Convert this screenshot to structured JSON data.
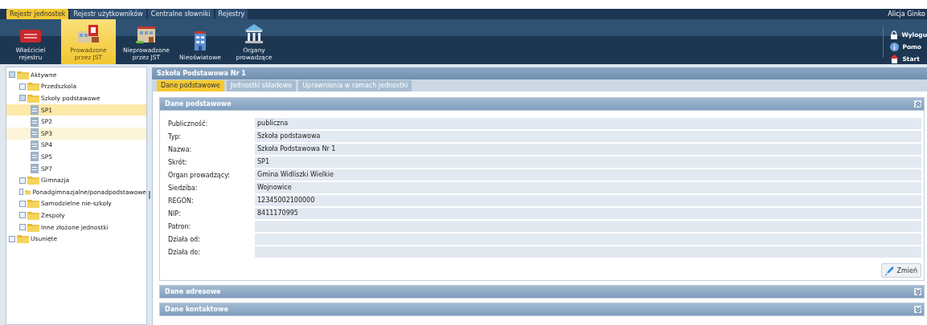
{
  "top_tabs": [
    {
      "label": "Rejestr jednostek",
      "selected": true
    },
    {
      "label": "Rejestr użytkowników",
      "selected": false
    },
    {
      "label": "Centralne słowniki",
      "selected": false
    },
    {
      "label": "Rejestry",
      "selected": false
    }
  ],
  "user": "Alicja Ginko",
  "toolbar": [
    {
      "label": "Właściciel rejestru",
      "kind": "sign",
      "selected": false
    },
    {
      "label": "Prowadzone przez JST",
      "kind": "emblem",
      "selected": true
    },
    {
      "label": "Nieprowadzone przez JST",
      "kind": "building",
      "selected": false
    },
    {
      "label": "Nieoświatowe",
      "kind": "tower",
      "selected": false
    },
    {
      "label": "Organy prowadzące",
      "kind": "temple",
      "selected": false
    }
  ],
  "side_links": [
    {
      "label": "Wylogu",
      "kind": "lock"
    },
    {
      "label": "Pomo",
      "kind": "info"
    },
    {
      "label": "Start",
      "kind": "home"
    }
  ],
  "tree": [
    {
      "label": "Aktywne",
      "kind": "folder",
      "expanded": true,
      "selected": false,
      "hovered": false,
      "children": [
        {
          "label": "Przedszkola",
          "kind": "folder",
          "expanded": false,
          "selected": false,
          "hovered": false
        },
        {
          "label": "Szkoły podstawowe",
          "kind": "folder",
          "expanded": true,
          "selected": false,
          "hovered": false,
          "children": [
            {
              "label": "SP1",
              "kind": "doc",
              "selected": true,
              "hovered": false
            },
            {
              "label": "SP2",
              "kind": "doc",
              "selected": false,
              "hovered": false
            },
            {
              "label": "SP3",
              "kind": "doc",
              "selected": false,
              "hovered": true
            },
            {
              "label": "SP4",
              "kind": "doc",
              "selected": false,
              "hovered": false
            },
            {
              "label": "SP5",
              "kind": "doc",
              "selected": false,
              "hovered": false
            },
            {
              "label": "SP7",
              "kind": "doc",
              "selected": false,
              "hovered": false
            }
          ]
        },
        {
          "label": "Gimnazja",
          "kind": "folder",
          "expanded": false,
          "selected": false,
          "hovered": false
        },
        {
          "label": "Ponadgimnazjalne/ponadpodstawowe",
          "kind": "folder",
          "expanded": false,
          "selected": false,
          "hovered": false
        },
        {
          "label": "Samodzielne nie-szkoły",
          "kind": "folder",
          "expanded": false,
          "selected": false,
          "hovered": false
        },
        {
          "label": "Zespoły",
          "kind": "folder",
          "expanded": false,
          "selected": false,
          "hovered": false
        },
        {
          "label": "Inne złożone jednostki",
          "kind": "folder",
          "expanded": false,
          "selected": false,
          "hovered": false
        }
      ]
    },
    {
      "label": "Usunięte",
      "kind": "folder",
      "expanded": false,
      "selected": false,
      "hovered": false
    }
  ],
  "detail": {
    "title": "Szkoła Podstawowa Nr 1",
    "tabs": [
      {
        "label": "Dane podstawowe",
        "selected": true
      },
      {
        "label": "Jednostki składowe",
        "selected": false
      },
      {
        "label": "Uprawnienia w ramach jednostki",
        "selected": false
      }
    ],
    "sections": [
      {
        "title": "Dane podstawowe",
        "expanded": true,
        "fields": [
          {
            "label": "Publiczność:",
            "value": "publiczna"
          },
          {
            "label": "Typ:",
            "value": "Szkoła podstawowa"
          },
          {
            "label": "Nazwa:",
            "value": "Szkoła Podstawowa Nr 1"
          },
          {
            "label": "Skrót:",
            "value": "SP1"
          },
          {
            "label": "Organ prowadzący:",
            "value": "Gmina Widliszki Wielkie"
          },
          {
            "label": "Siedziba:",
            "value": "Wojnowice"
          },
          {
            "label": "REGON:",
            "value": "12345002100000"
          },
          {
            "label": "NIP:",
            "value": "8411170995"
          },
          {
            "label": "Patron:"
          },
          {
            "label": "Działa od:"
          },
          {
            "label": "Działa do:"
          }
        ],
        "button": "Zmień"
      },
      {
        "title": "Dane adresowe",
        "expanded": false
      },
      {
        "title": "Dane kontaktowe",
        "expanded": false
      }
    ]
  }
}
